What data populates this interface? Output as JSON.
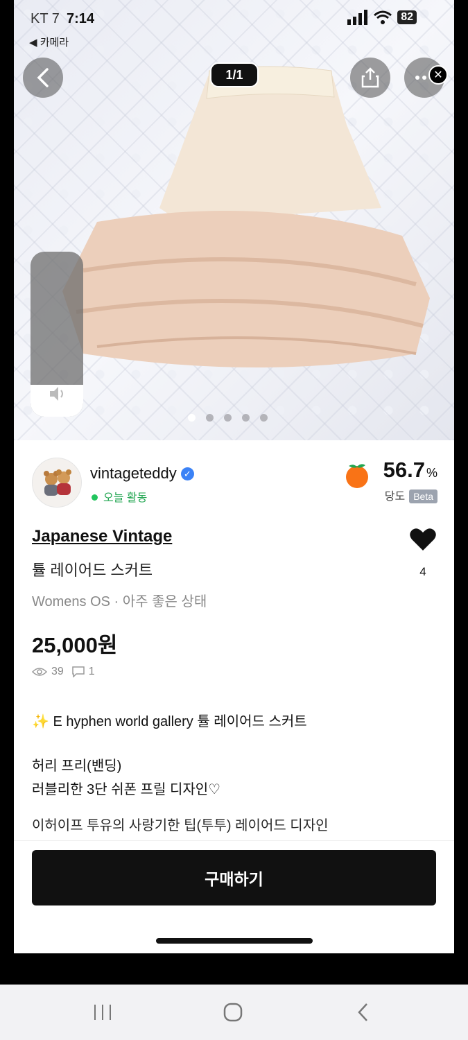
{
  "status_bar": {
    "carrier": "KT 7",
    "time": "7:14",
    "battery": "82"
  },
  "camera_back_label": "◀ 카메라",
  "photo": {
    "counter": "1/1",
    "dots_count": 5,
    "active_dot": 0
  },
  "seller": {
    "name": "vintageteddy",
    "activity": "오늘 활동",
    "temperature": "56.7",
    "temperature_unit": "%",
    "temperature_label": "당도",
    "beta_label": "Beta"
  },
  "product": {
    "brand_title": "Japanese Vintage",
    "name": "튤 레이어드 스커트",
    "meta": "Womens OS · 아주 좋은 상태",
    "price": "25,000원",
    "views": "39",
    "chats": "1",
    "likes": "4"
  },
  "description": {
    "line1": "✨ E hyphen world gallery 튤 레이어드 스커트",
    "line2": "허리 프리(밴딩)",
    "line3": "러블리한 3단 쉬폰 프릴 디자인♡",
    "line4_cut": "이허이프 투유의 사랑기한 팁(투투) 레이어드 디자인"
  },
  "buy_button": "구매하기",
  "colors": {
    "accent_green": "#22c55e",
    "verified_blue": "#3b82f6",
    "button": "#111111"
  }
}
